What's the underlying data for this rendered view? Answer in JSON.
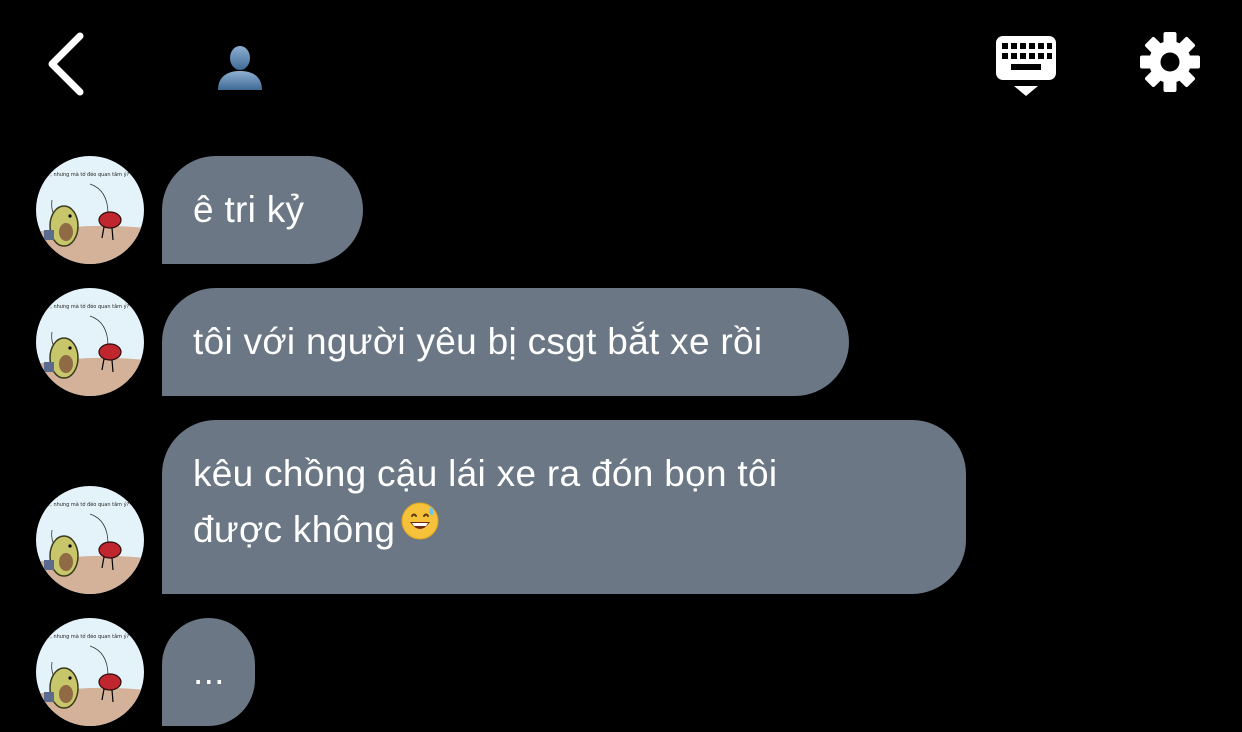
{
  "header": {
    "back_icon": "chevron-left-icon",
    "contact_icon": "person-silhouette-icon",
    "keyboard_icon": "keyboard-icon",
    "settings_icon": "gear-icon"
  },
  "messages": [
    {
      "lines": [
        "ê tri kỷ"
      ]
    },
    {
      "lines": [
        "tôi với người yêu bị csgt bắt xe rồi"
      ]
    },
    {
      "lines": [
        "kêu chồng cậu lái xe ra đón bọn tôi",
        "được không"
      ],
      "emoji": "grinning-face-with-sweat-icon"
    },
    {
      "lines": [
        "..."
      ]
    }
  ],
  "avatar_caption": "Ừ, nhưng mà tớ đéo quan tâm ý?",
  "colors": {
    "background": "#000000",
    "bubble": "#6b7784",
    "text": "#ffffff"
  }
}
